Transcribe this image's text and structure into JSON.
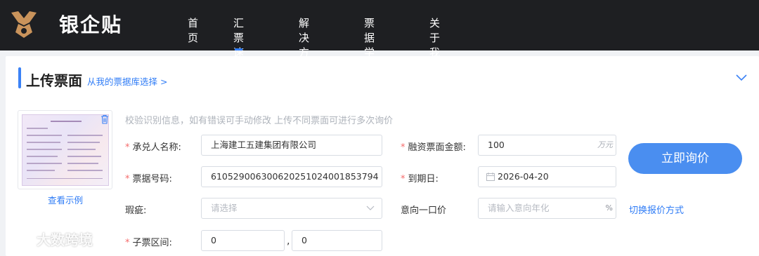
{
  "brand": {
    "name": "银企贴"
  },
  "nav": {
    "items": [
      {
        "label": "首页"
      },
      {
        "label": "汇票速融",
        "active": true
      },
      {
        "label": "解决方案"
      },
      {
        "label": "票据学院"
      },
      {
        "label": "关于我们"
      }
    ]
  },
  "section": {
    "title": "上传票面",
    "select_link": "从我的票据库选择 >",
    "hint": "校验识别信息，如有错误可手动修改 上传不同票面可进行多次询价",
    "sample_link": "查看示例"
  },
  "form": {
    "acceptor": {
      "label": "承兑人名称:",
      "value": "上海建工五建集团有限公司",
      "required": true
    },
    "bill_no": {
      "label": "票据号码:",
      "value": "610529006300620251024001853794",
      "required": true
    },
    "defect": {
      "label": "瑕疵:",
      "placeholder": "请选择",
      "required": false
    },
    "sub_range": {
      "label": "子票区间:",
      "from": "0",
      "to": "0",
      "sep": ",",
      "required": true
    },
    "amount": {
      "label": "融资票面金额:",
      "value": "100",
      "unit": "万元",
      "required": true
    },
    "due_date": {
      "label": "到期日:",
      "value": "2026-04-20",
      "required": true
    },
    "price": {
      "label": "意向一口价",
      "placeholder": "请输入意向年化",
      "unit": "%"
    }
  },
  "actions": {
    "inquiry_button": "立即询价",
    "switch_link": "切换报价方式"
  },
  "watermark": {
    "text": "大数跨境"
  },
  "colors": {
    "accent": "#2f7cf6",
    "topbar": "#1e1f22",
    "button": "#4a8ef0",
    "required": "#f56c6c"
  }
}
